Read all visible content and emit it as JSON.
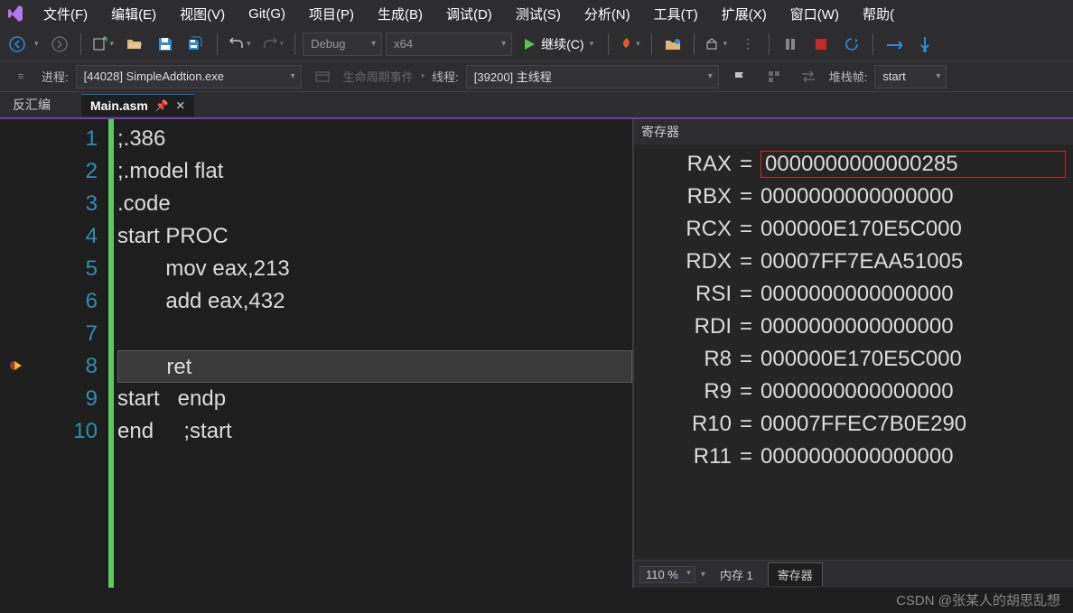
{
  "menu": [
    "文件(F)",
    "编辑(E)",
    "视图(V)",
    "Git(G)",
    "项目(P)",
    "生成(B)",
    "调试(D)",
    "测试(S)",
    "分析(N)",
    "工具(T)",
    "扩展(X)",
    "窗口(W)",
    "帮助("
  ],
  "toolbar": {
    "config": "Debug",
    "platform": "x64",
    "continue": "继续(C)"
  },
  "debugbar": {
    "process_label": "进程:",
    "process_value": "[44028] SimpleAddtion.exe",
    "lifecycle": "生命周期事件",
    "thread_label": "线程:",
    "thread_value": "[39200] 主线程",
    "stackframe_label": "堆栈帧:",
    "stackframe_value": "start"
  },
  "tabs": {
    "side": "反汇编",
    "file": "Main.asm"
  },
  "code": {
    "lines": [
      ";.386",
      ";.model flat",
      ".code",
      "start PROC",
      "        mov eax,213",
      "        add eax,432",
      "",
      "        ret",
      "start   endp",
      "end     ;start"
    ],
    "line_numbers": [
      "1",
      "2",
      "3",
      "4",
      "5",
      "6",
      "7",
      "8",
      "9",
      "10"
    ],
    "current_line": 8
  },
  "registers": {
    "title": "寄存器",
    "rows": [
      {
        "name": "RAX",
        "value": "0000000000000285",
        "highlight": true
      },
      {
        "name": "RBX",
        "value": "0000000000000000"
      },
      {
        "name": "RCX",
        "value": "000000E170E5C000"
      },
      {
        "name": "RDX",
        "value": "00007FF7EAA51005"
      },
      {
        "name": "RSI",
        "value": "0000000000000000"
      },
      {
        "name": "RDI",
        "value": "0000000000000000"
      },
      {
        "name": "R8",
        "value": "000000E170E5C000"
      },
      {
        "name": "R9",
        "value": "0000000000000000"
      },
      {
        "name": "R10",
        "value": "00007FFEC7B0E290"
      },
      {
        "name": "R11",
        "value": "0000000000000000"
      }
    ],
    "zoom": "110 %",
    "footer_tabs": {
      "mem": "内存 1",
      "reg": "寄存器"
    }
  },
  "watermark": "CSDN @张某人的胡思乱想"
}
